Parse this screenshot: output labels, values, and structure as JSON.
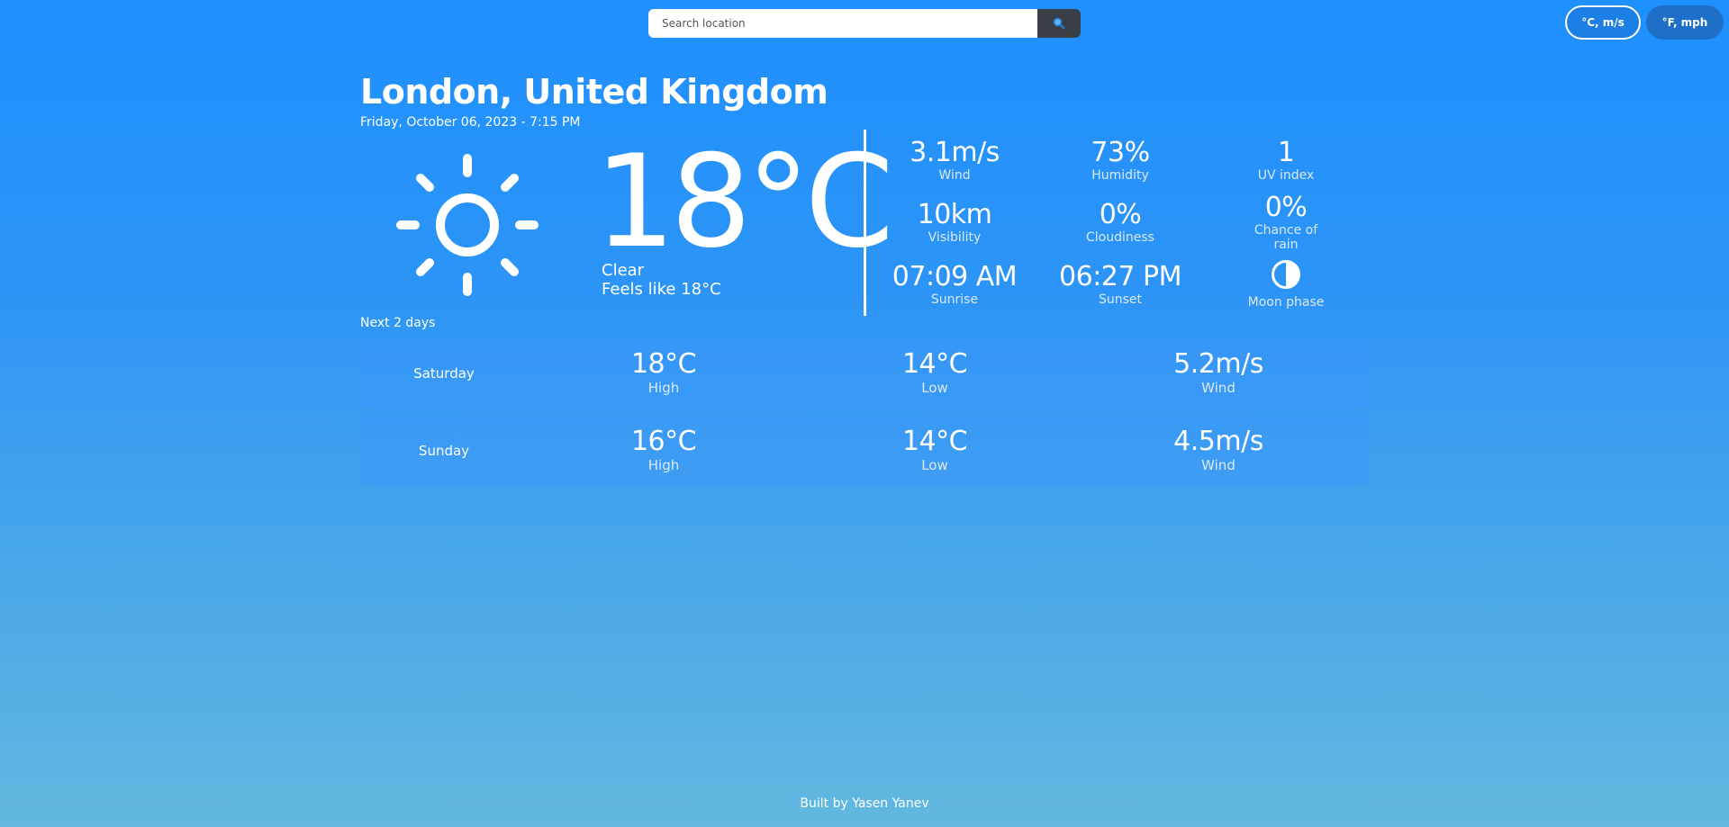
{
  "search": {
    "placeholder": "Search location",
    "button_icon": "search-icon"
  },
  "units": {
    "metric_label": "°C, m/s",
    "imperial_label": "°F, mph",
    "active": "metric"
  },
  "location": {
    "city": "London, United Kingdom",
    "datetime": "Friday, October 06, 2023 - 7:15 PM"
  },
  "current": {
    "icon": "sun-icon",
    "temperature": "18°C",
    "condition": "Clear",
    "feels_like": "Feels like 18°C"
  },
  "stats": [
    {
      "value": "3.1m/s",
      "label": "Wind"
    },
    {
      "value": "73%",
      "label": "Humidity"
    },
    {
      "value": "1",
      "label": "UV index"
    },
    {
      "value": "10km",
      "label": "Visibility"
    },
    {
      "value": "0%",
      "label": "Cloudiness"
    },
    {
      "value": "0%",
      "label": "Chance of rain"
    },
    {
      "value": "07:09 AM",
      "label": "Sunrise"
    },
    {
      "value": "06:27 PM",
      "label": "Sunset"
    },
    {
      "icon": "moon-phase-icon",
      "label": "Moon phase"
    }
  ],
  "forecast": {
    "title": "Next 2 days",
    "days": [
      {
        "name": "Saturday",
        "high": "18°C",
        "high_label": "High",
        "low": "14°C",
        "low_label": "Low",
        "wind": "5.2m/s",
        "wind_label": "Wind"
      },
      {
        "name": "Sunday",
        "high": "16°C",
        "high_label": "High",
        "low": "14°C",
        "low_label": "Low",
        "wind": "4.5m/s",
        "wind_label": "Wind"
      }
    ]
  },
  "footer": {
    "text": "Built by Yasen Yanev"
  }
}
